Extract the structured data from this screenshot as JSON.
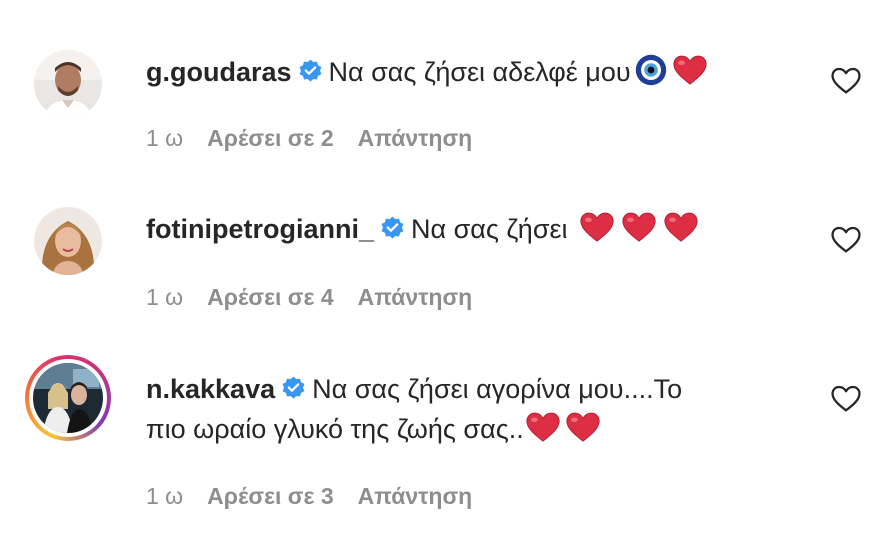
{
  "comments": [
    {
      "username": "g.goudaras",
      "text": "Να σας ζήσει αδελφέ μου",
      "emoji": [
        "nazar-amulet-emoji",
        "red-heart-emoji"
      ],
      "time": "1 ω",
      "likes": "Αρέσει σε 2",
      "reply": "Απάντηση"
    },
    {
      "username": "fotinipetrogianni_",
      "text": "Να σας ζήσει",
      "emoji": [
        "red-heart-emoji",
        "red-heart-emoji",
        "red-heart-emoji"
      ],
      "time": "1 ω",
      "likes": "Αρέσει σε 4",
      "reply": "Απάντηση"
    },
    {
      "username": "n.kakkava",
      "text_line1": "Να σας ζήσει αγορίνα μου....Το",
      "text_line2": "πιο ωραίο γλυκό της ζωής σας..",
      "emoji": [
        "red-heart-emoji",
        "red-heart-emoji"
      ],
      "time": "1 ω",
      "likes": "Αρέσει σε 3",
      "reply": "Απάντηση"
    }
  ],
  "colors": {
    "text": "#262626",
    "meta": "#8e8e8e",
    "verified": "#3897f0",
    "heart": "#dd2e44"
  }
}
